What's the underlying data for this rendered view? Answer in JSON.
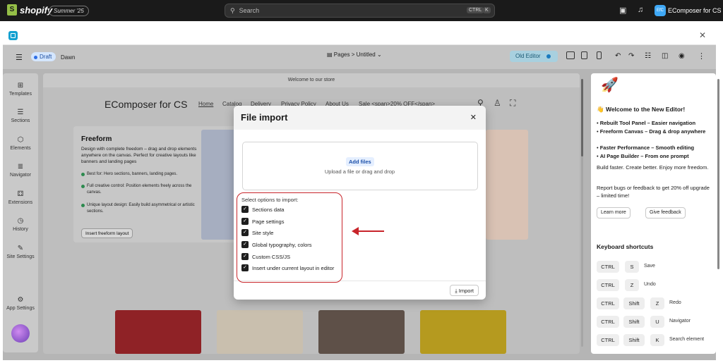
{
  "shopify": {
    "brand": "shopify",
    "edition": "Summer '25",
    "search_placeholder": "Search",
    "kbd_ctrl": "CTRL",
    "kbd_k": "K",
    "store_initials": "EfC",
    "store_name": "EComposer for CS"
  },
  "editor": {
    "draft_label": "Draft",
    "theme_name": "Dawn",
    "pages_label": "Pages",
    "page_sep": ">",
    "page_name": "Untitled",
    "old_editor_label": "Old Editor"
  },
  "sidebar": {
    "items": [
      {
        "label": "Templates",
        "icon": "⊞"
      },
      {
        "label": "Sections",
        "icon": "☰"
      },
      {
        "label": "Elements",
        "icon": "⬡"
      },
      {
        "label": "Navigator",
        "icon": "≣"
      },
      {
        "label": "Extensions",
        "icon": "⚃"
      },
      {
        "label": "History",
        "icon": "◷"
      },
      {
        "label": "Site Settings",
        "icon": "✎"
      },
      {
        "label": "App Settings",
        "icon": "⚙"
      }
    ]
  },
  "canvas": {
    "welcome": "Welcome to our store",
    "store_title": "EComposer for CS",
    "nav": [
      "Home",
      "Catalog",
      "Delivery",
      "Privacy Policy",
      "About Us",
      "Sale <span>20% OFF</span>"
    ],
    "freeform_title": "Freeform",
    "freeform_text": "Design with complete freedom – drag and drop elements anywhere on the canvas. Perfect for creative layouts like banners and landing pages",
    "bullets": [
      "Best for: Hero sections, banners, landing pages.",
      "Full creative control: Position elements freely across the canvas.",
      "Unique layout design: Easily build asymmetrical or artistic sections."
    ],
    "freeform_button": "Insert freeform layout"
  },
  "right_panel": {
    "welcome_title": "Welcome to the New Editor!",
    "features": [
      "Rebuilt Tool Panel – Easier navigation",
      "Freeform Canvas – Drag & drop anywhere",
      "Faster Performance – Smooth editing",
      "AI Page Builder – From one prompt"
    ],
    "tagline": "Build faster. Create better. Enjoy more freedom.",
    "report_text": "Report bugs or feedback to get 20% off upgrade – limited time!",
    "learn_more": "Learn more",
    "give_feedback": "Give feedback",
    "shortcuts_title": "Keyboard shortcuts",
    "shortcuts": [
      {
        "keys": [
          "CTRL",
          "S"
        ],
        "desc": "Save"
      },
      {
        "keys": [
          "CTRL",
          "Z"
        ],
        "desc": "Undo"
      },
      {
        "keys": [
          "CTRL",
          "Shift",
          "Z"
        ],
        "desc": "Redo"
      },
      {
        "keys": [
          "CTRL",
          "Shift",
          "U"
        ],
        "desc": "Navigator"
      },
      {
        "keys": [
          "CTRL",
          "Shift",
          "K"
        ],
        "desc": "Search element"
      }
    ]
  },
  "modal": {
    "title": "File import",
    "add_files": "Add files",
    "upload_hint": "Upload a file or drag and drop",
    "options_label": "Select options to import:",
    "options": [
      {
        "label": "Sections data",
        "checked": true
      },
      {
        "label": "Page settings",
        "checked": true
      },
      {
        "label": "Site style",
        "checked": true
      },
      {
        "label": "Global typography, colors",
        "checked": true
      },
      {
        "label": "Custom CSS/JS",
        "checked": true
      },
      {
        "label": "Insert under current layout in editor",
        "checked": true
      }
    ],
    "import_label": "Import"
  },
  "colors": {
    "annotation": "#c8242a",
    "brand": "#95bf47",
    "accent": "#12a1d1"
  }
}
